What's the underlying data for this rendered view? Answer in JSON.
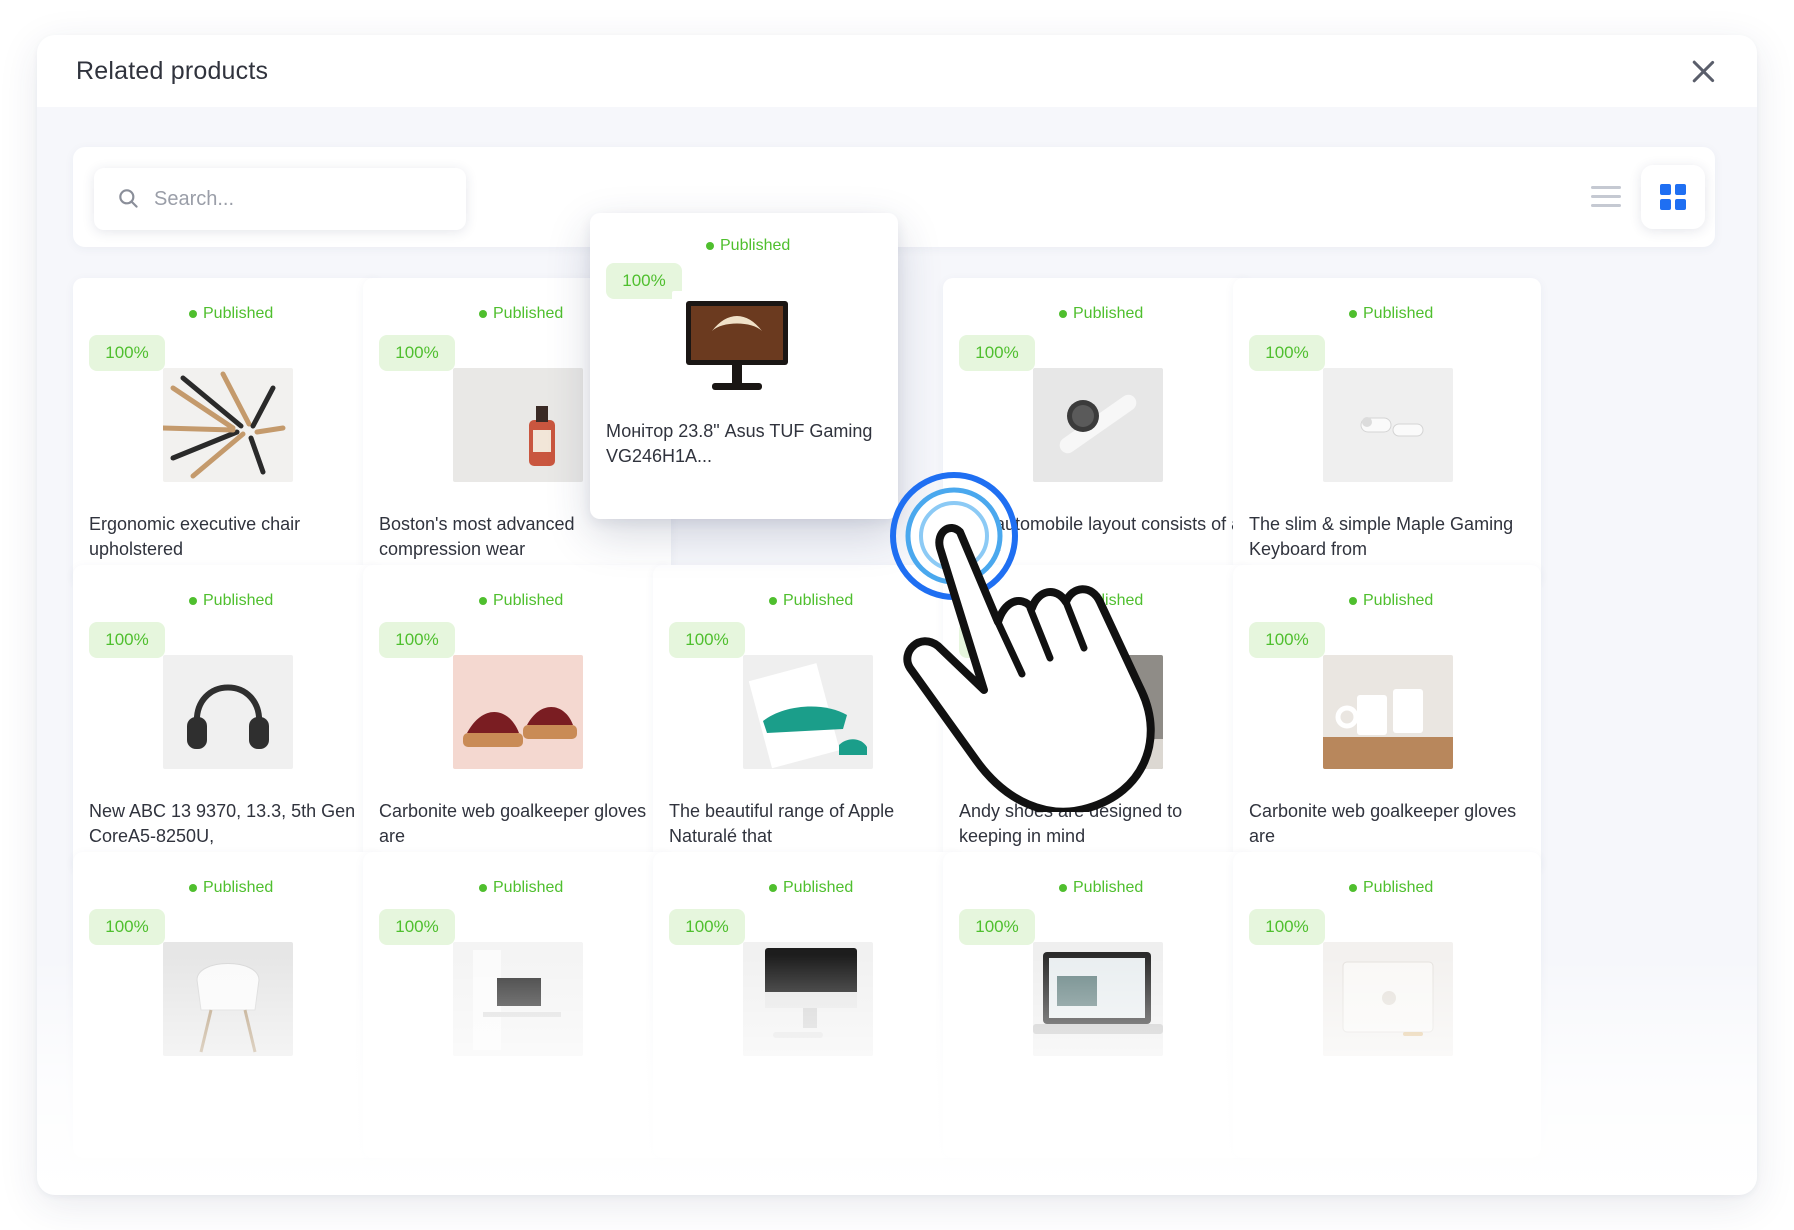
{
  "modal": {
    "title": "Related products"
  },
  "search": {
    "placeholder": "Search..."
  },
  "colors": {
    "accent": "#1f6ff2",
    "published": "#4fbf2e",
    "badge_bg": "#e6f6dd"
  },
  "icons": {
    "close": "close-icon",
    "search": "search-icon",
    "list_view": "list-view-icon",
    "grid_view": "grid-view-icon",
    "cursor": "hand-pointer-icon"
  },
  "products": [
    {
      "status": "Published",
      "percent": "100%",
      "title": "Ergonomic executive chair upholstered",
      "image": "makeup-brushes"
    },
    {
      "status": "Published",
      "percent": "100%",
      "title": "Boston's most advanced compression wear",
      "image": "serum-bottle"
    },
    {
      "status": "Published",
      "percent": "100%",
      "title": "Монітор 23.8\" Asus TUF Gaming VG246H1A...",
      "image": "gaming-monitor"
    },
    {
      "status": "Published",
      "percent": "100%",
      "title": "The automobile layout consists of a front-",
      "image": "smartwatch"
    },
    {
      "status": "Published",
      "percent": "100%",
      "title": "The slim & simple Maple Gaming Keyboard from",
      "image": "earbuds"
    },
    {
      "status": "Published",
      "percent": "100%",
      "title": "New ABC 13 9370, 13.3, 5th Gen CoreA5-8250U,",
      "image": "headphones"
    },
    {
      "status": "Published",
      "percent": "100%",
      "title": "Carbonite web goalkeeper gloves are",
      "image": "sandals"
    },
    {
      "status": "Published",
      "percent": "100%",
      "title": "The beautiful range of Apple Naturalé that",
      "image": "green-shoes"
    },
    {
      "status": "Published",
      "percent": "100%",
      "title": "Andy shoes are designed to keeping in mind",
      "image": "lotion-bottle"
    },
    {
      "status": "Published",
      "percent": "100%",
      "title": "Carbonite web goalkeeper gloves are",
      "image": "mugs"
    },
    {
      "status": "Published",
      "percent": "100%",
      "title": "",
      "image": "white-chair"
    },
    {
      "status": "Published",
      "percent": "100%",
      "title": "",
      "image": "desk-setup"
    },
    {
      "status": "Published",
      "percent": "100%",
      "title": "",
      "image": "imac"
    },
    {
      "status": "Published",
      "percent": "100%",
      "title": "",
      "image": "laptop"
    },
    {
      "status": "Published",
      "percent": "100%",
      "title": "",
      "image": "white-laptop"
    }
  ]
}
